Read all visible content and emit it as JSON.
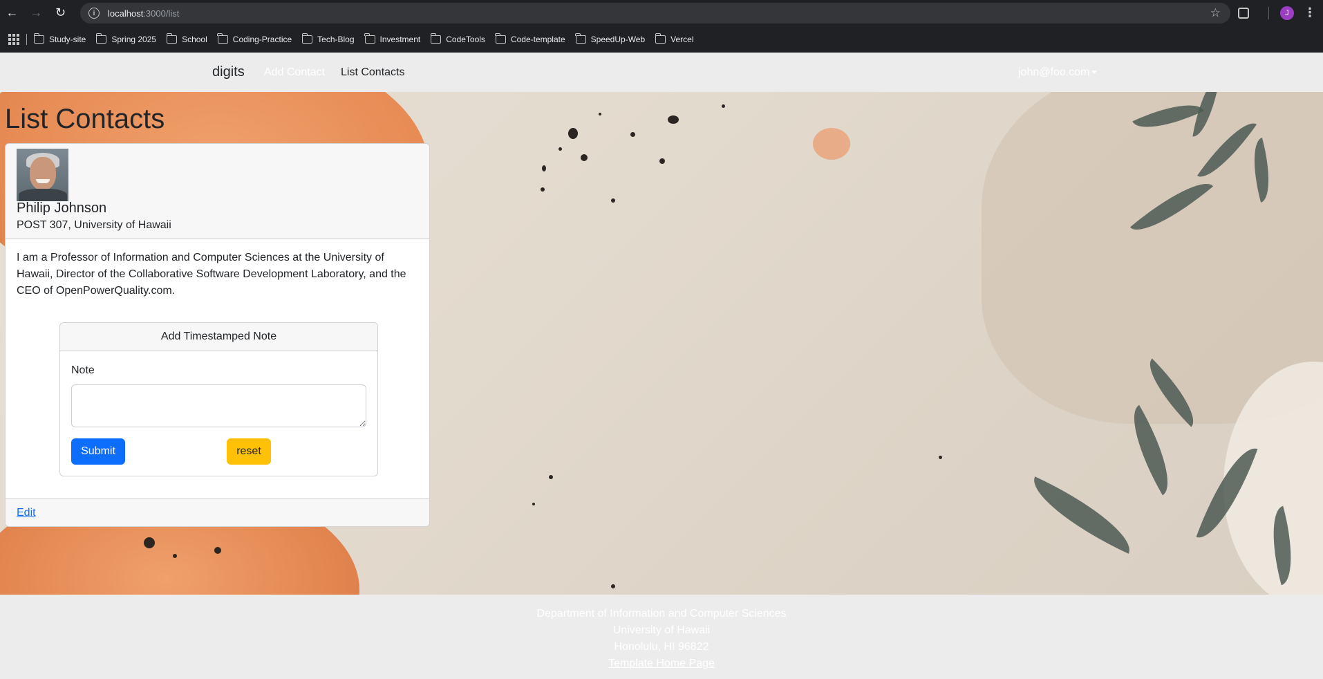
{
  "browser": {
    "url_host": "localhost",
    "url_path": ":3000/list",
    "bookmarks": [
      "Study-site",
      "Spring 2025",
      "School",
      "Coding-Practice",
      "Tech-Blog",
      "Investment",
      "CodeTools",
      "Code-template",
      "SpeedUp-Web",
      "Vercel"
    ],
    "profile_initial": "J"
  },
  "navbar": {
    "brand": "digits",
    "add_contact": "Add Contact",
    "list_contacts": "List Contacts",
    "user": "john@foo.com"
  },
  "main": {
    "title": "List Contacts",
    "contact": {
      "name": "Philip Johnson",
      "address": "POST 307, University of Hawaii",
      "description": "I am a Professor of Information and Computer Sciences at the University of Hawaii, Director of the Collaborative Software Development Laboratory, and the CEO of OpenPowerQuality.com.",
      "note_form": {
        "header": "Add Timestamped Note",
        "label": "Note",
        "value": "",
        "submit": "Submit",
        "reset": "reset"
      },
      "edit": "Edit"
    }
  },
  "footer": {
    "line1": "Department of Information and Computer Sciences",
    "line2": "University of Hawaii",
    "line3": "Honolulu, HI 96822",
    "link": "Template Home Page"
  },
  "colors": {
    "primary": "#0d6efd",
    "warning": "#ffc107",
    "chrome": "#202124",
    "navbar": "#ececec"
  }
}
